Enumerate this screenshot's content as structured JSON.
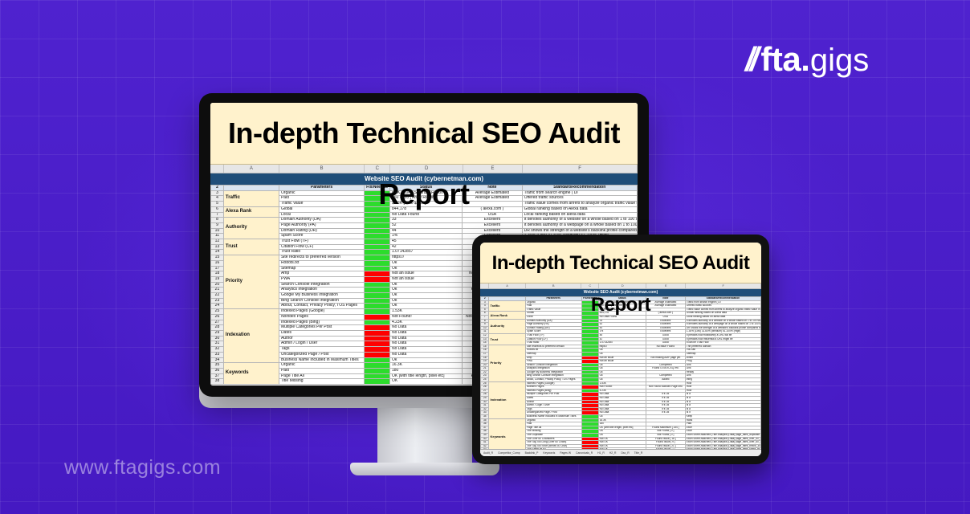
{
  "brand": {
    "slashes": "//",
    "name": "fta",
    "dot": ".",
    "suffix": "gigs",
    "website": "www.ftagigs.com"
  },
  "report": {
    "title": "In-depth Technical SEO Audit Report",
    "sheet_title": "Website SEO Audit (cybernetman.com)",
    "column_letters": [
      "",
      "A",
      "B",
      "C",
      "D",
      "E",
      "F"
    ],
    "headers": [
      "Parameters",
      "Fix/Need to",
      "Status",
      "Note",
      "Standard/Recommendation"
    ],
    "rows": [
      {
        "cat": "Traffic",
        "param": "Organic",
        "fix": "g",
        "status": "8.4K - 10K [ Semrush Report ]",
        "note": "Average Estimated",
        "rec": "Traffic from search engine ( Di"
      },
      {
        "cat": "",
        "param": "Paid",
        "fix": "g",
        "status": "160 - 210 [ Ahref Report ]",
        "note": "Average Estimated",
        "rec": "Offered traffic sources"
      },
      {
        "cat": "",
        "param": "Traffic Value",
        "fix": "g",
        "status": "$4.3K [PPC-$2.6K]",
        "note": "",
        "rec": "Traffic value comes from ahrefs to analyze organic traffic value in USD currency. (Estimated)"
      },
      {
        "cat": "Alexa Rank",
        "param": "Global",
        "fix": "g",
        "status": "844,178",
        "note": "( alexa.com )",
        "rec": "Global ranking based on Alexa data"
      },
      {
        "cat": "",
        "param": "Local",
        "fix": "g",
        "status": "No Data Found",
        "note": "USA",
        "rec": "Local ranking based on alexa data"
      },
      {
        "cat": "Authority",
        "param": "Domain Authority (DA)",
        "fix": "g",
        "status": "33",
        "note": "Excellent",
        "rec": "It denotes authority of a website on a whole based on 1 to 100 score given by Moz. The more, the bet"
      },
      {
        "cat": "",
        "param": "Page Authority (PA)",
        "fix": "g",
        "status": "52",
        "note": "Excellent",
        "rec": "It denotes authority of a webpage on a whole based on 1 to 100 score given by Moz. The more, the bet"
      },
      {
        "cat": "",
        "param": "Domain Rating (DR)",
        "fix": "g",
        "status": "44",
        "note": "Excellent",
        "rec": "DR shows the strength of a website's backlink profile compared to the others in our database on a 10"
      },
      {
        "cat": "",
        "param": "Spam Score",
        "fix": "g",
        "status": "1%",
        "note": "Excellent",
        "rec": "1-30% (Low) 31-60% (Medium) 61-100% (High)"
      },
      {
        "cat": "Trust",
        "param": "Trust Flow (TF)",
        "fix": "g",
        "status": "45",
        "note": "Good",
        "rec": "It predicts how trustworthy a URL will be"
      },
      {
        "cat": "",
        "param": "Citation Flow (CF)",
        "fix": "g",
        "status": "42",
        "note": "Good",
        "rec": "It predicts how influential a URL might be"
      },
      {
        "cat": "",
        "param": "Trust Ratio",
        "fix": "g",
        "status": "1.07142857",
        "note": "Good",
        "rec": "It can be Trust Flow"
      },
      {
        "cat": "Priority",
        "param": "Site redirects to preferred version",
        "fix": "g",
        "status": "https://",
        "note": "No issue Found",
        "rec": "The preferred domain"
      },
      {
        "cat": "",
        "param": "Robots.txt",
        "fix": "g",
        "status": "Ok",
        "note": "",
        "rec": "You can"
      },
      {
        "cat": "",
        "param": "Sitemap",
        "fix": "g",
        "status": "Ok",
        "note": "",
        "rec": "Sitemap"
      },
      {
        "cat": "",
        "param": "Amp",
        "fix": "r",
        "status": "Not an issue",
        "note": "Not making AMP page yet",
        "rec": "When"
      },
      {
        "cat": "",
        "param": "PWA",
        "fix": "r",
        "status": "Not an issue",
        "note": "",
        "rec": "Prog"
      },
      {
        "cat": "",
        "param": "Search Console Integration",
        "fix": "g",
        "status": "Ok",
        "note": "Completed",
        "rec": "Link"
      },
      {
        "cat": "",
        "param": "Analytics Integration",
        "fix": "g",
        "status": "Ok",
        "note": "Found GTM-KCXQ7HE",
        "rec": "Link"
      },
      {
        "cat": "",
        "param": "Google My Business Integration",
        "fix": "g",
        "status": "Ok",
        "note": "",
        "rec": "Ready"
      },
      {
        "cat": "",
        "param": "Bing Search Console Integration",
        "fix": "g",
        "status": "Ok",
        "note": "Completed",
        "rec": "Link"
      },
      {
        "cat": "",
        "param": "About, Contact, Privacy Policy, TOS Pages",
        "fix": "g",
        "status": "Ok",
        "note": "Added",
        "rec": "Integ"
      },
      {
        "cat": "Indexation",
        "param": "Indexed Pages (Google)",
        "fix": "g",
        "status": "1.53K",
        "note": "",
        "rec": "How"
      },
      {
        "cat": "",
        "param": "Noindex Pages",
        "fix": "r",
        "status": "Not Found!",
        "note": "Not Found Noindex Page Info",
        "rec": "How"
      },
      {
        "cat": "",
        "param": "Indexed Pages (Bing)",
        "fix": "g",
        "status": "4.23K",
        "note": "",
        "rec": "How"
      },
      {
        "cat": "",
        "param": "Multiple Categories Per Post",
        "fix": "r",
        "status": "No Data",
        "note": "It's Ok",
        "rec": "Is a"
      },
      {
        "cat": "",
        "param": "Dates",
        "fix": "r",
        "status": "No Data",
        "note": "It's Ok",
        "rec": "Is a"
      },
      {
        "cat": "",
        "param": "Author",
        "fix": "r",
        "status": "No Data",
        "note": "It's Ok",
        "rec": "Is a"
      },
      {
        "cat": "",
        "param": "Admin / Login / User",
        "fix": "r",
        "status": "No Data",
        "note": "It's Ok",
        "rec": "Is a"
      },
      {
        "cat": "",
        "param": "Tags",
        "fix": "r",
        "status": "No Data",
        "note": "It's Ok",
        "rec": "Is a"
      },
      {
        "cat": "",
        "param": "Uncategorized Page / Post",
        "fix": "r",
        "status": "No Data",
        "note": "It's Ok",
        "rec": "Is it"
      },
      {
        "cat": "",
        "param": "Business Name Included in Maximum Titles",
        "fix": "g",
        "status": "Ok",
        "note": "",
        "rec": "Keep"
      },
      {
        "cat": "Keywords",
        "param": "Organic",
        "fix": "g",
        "status": "16.3K",
        "note": "",
        "rec": "Rank"
      },
      {
        "cat": "",
        "param": "Paid",
        "fix": "g",
        "status": "180",
        "note": "",
        "rec": "Paid"
      },
      {
        "cat": "",
        "param": "Page Title All",
        "fix": "g",
        "status": "OK [with title length, pixel etc]",
        "note": "Found Maximum [ 154 ]",
        "rec": "Exce"
      },
      {
        "cat": "",
        "param": "Title Missing",
        "fix": "g",
        "status": "OK",
        "note": "Not Found [ 0 ]",
        "rec": "Exce"
      }
    ],
    "tablet_extra_rows": [
      {
        "cat": "",
        "param": "Title Duplicate",
        "fix": "g",
        "status": "OK",
        "note": "Not Found [ 0 ]",
        "rec": "Excel Sheet Attached (Title Analysis (Data) page_titles_duplicate.xlsx)"
      },
      {
        "cat": "",
        "param": "Title Over 60 Characters",
        "fix": "r",
        "status": "Not OK",
        "note": "Found Issue [ 18 ]",
        "rec": "Excel Sheet Attached (Title Analysis (Data) page_titles_over_60_characters.xlsx)"
      },
      {
        "cat": "",
        "param": "Title Tag Too Long (Over 60 Chars)",
        "fix": "r",
        "status": "Not OK",
        "note": "Found Issue [ 9 ]",
        "rec": "Excel Sheet Attached (Title Analysis (Data) page_titles_over_60_characters.xlsx)"
      },
      {
        "cat": "",
        "param": "Title Tag Too Short (Below 30 Char)",
        "fix": "r",
        "status": "Not OK",
        "note": "Found Issue [ 21 ]",
        "rec": "Excel Sheet Attached (Title Analysis (Data) page_titles_below_30_characters.xlsx)"
      },
      {
        "cat": "",
        "param": "Title Same as H1",
        "fix": "r",
        "status": "Not OK",
        "note": "Found Issue [ 1 ]",
        "rec": "Excel Sheet Attached (Title Analysis (Data) page_titles_same_as_h1.xlsx)"
      },
      {
        "cat": "",
        "param": "Title Below 200 Pixels",
        "fix": "r",
        "status": "Not OK",
        "note": "Found Issue [ 1 ]",
        "rec": "Excel Sheet Attached (Title Analysis (Data) page_titles_below_200_pixels.xlsx)"
      }
    ],
    "sheet_tabs": [
      "Audit_R",
      "Competitor_Comp",
      "Backlink_P",
      "Keywords",
      "Pages W",
      "Canonicals_R",
      "H1_R",
      "H2_R",
      "Dsc_R",
      "Title_R"
    ]
  },
  "colors": {
    "background": "#4a1fc9",
    "title_band": "#fff2cc",
    "sheet_header": "#1f4e79",
    "fix_green": "#2cdc2c",
    "fix_red": "#ff0000"
  }
}
